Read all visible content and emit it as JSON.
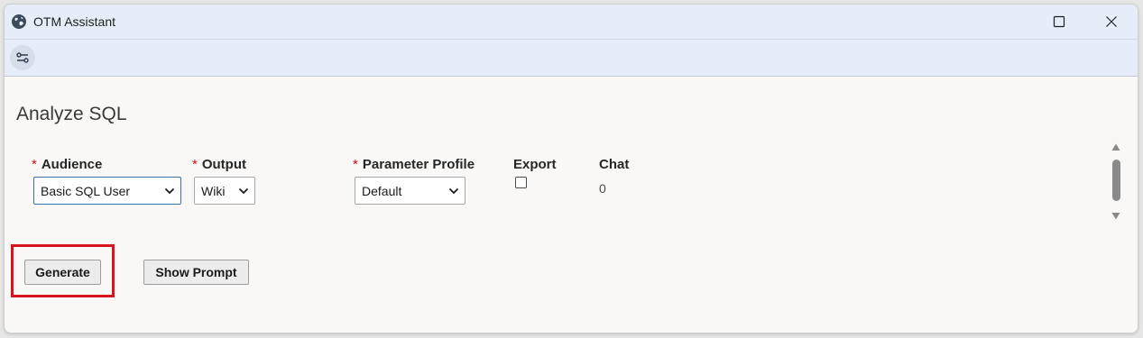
{
  "window": {
    "title": "OTM Assistant",
    "icons": {
      "app": "globe-icon",
      "maximize": "maximize-icon",
      "close": "close-icon"
    }
  },
  "toolbar": {
    "settings_icon": "sliders-icon"
  },
  "page": {
    "title": "Analyze SQL"
  },
  "form": {
    "required_marker": "*",
    "audience": {
      "label": "Audience",
      "required": true,
      "selected": "Basic SQL User"
    },
    "output": {
      "label": "Output",
      "required": true,
      "selected": "Wiki"
    },
    "parameter_profile": {
      "label": "Parameter Profile",
      "required": true,
      "selected": "Default"
    },
    "export": {
      "label": "Export",
      "checked": false
    },
    "chat": {
      "label": "Chat",
      "value": "0"
    }
  },
  "actions": {
    "generate_label": "Generate",
    "show_prompt_label": "Show Prompt"
  },
  "annotation": {
    "highlight_color": "#d8141f",
    "highlight_target": "generate-button"
  },
  "colors": {
    "titlebar_bg": "#e6edf9",
    "content_bg": "#f9f8f7",
    "required": "#c8101e",
    "focus_border": "#3b6fa8"
  }
}
